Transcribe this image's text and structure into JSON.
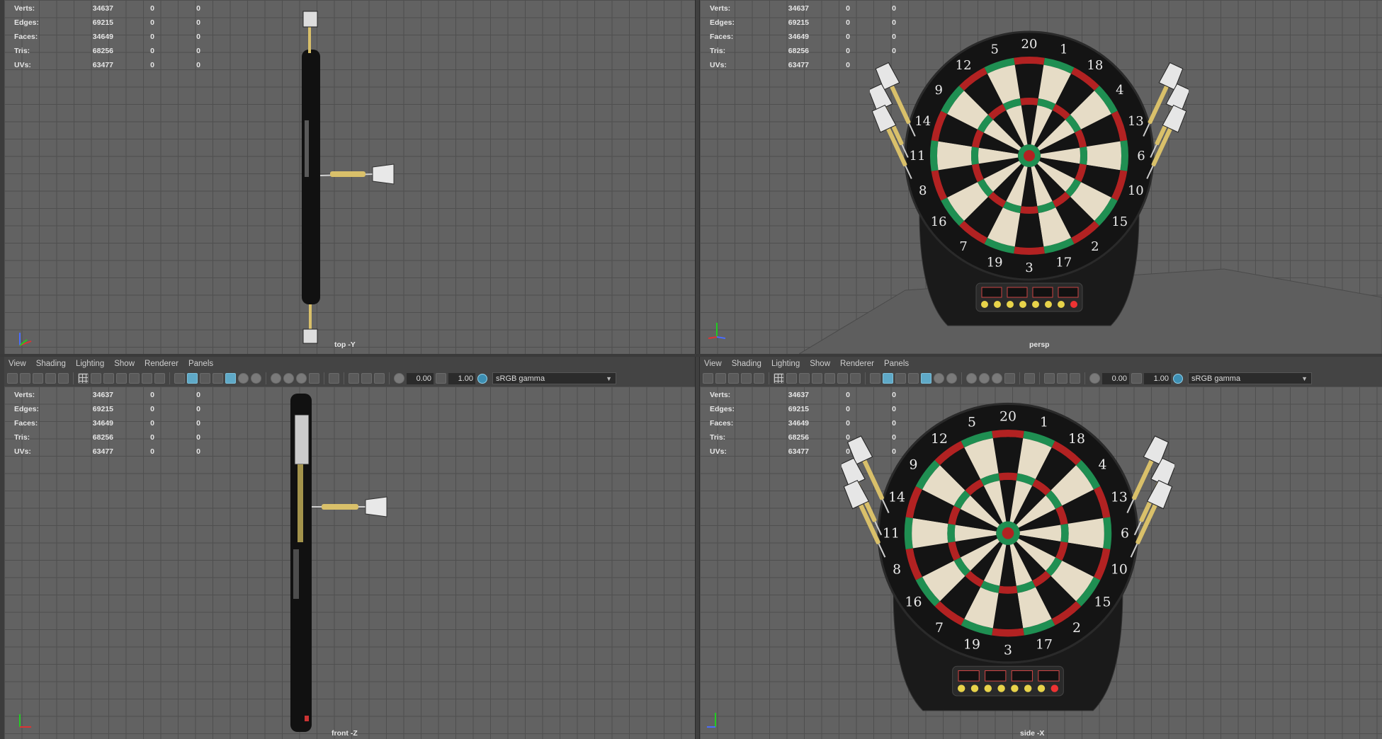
{
  "hud_stats": [
    {
      "label": "Verts:",
      "v1": "34637",
      "v2": "0",
      "v3": "0"
    },
    {
      "label": "Edges:",
      "v1": "69215",
      "v2": "0",
      "v3": "0"
    },
    {
      "label": "Faces:",
      "v1": "34649",
      "v2": "0",
      "v3": "0"
    },
    {
      "label": "Tris:",
      "v1": "68256",
      "v2": "0",
      "v3": "0"
    },
    {
      "label": "UVs:",
      "v1": "63477",
      "v2": "0",
      "v3": "0"
    }
  ],
  "viewports": {
    "top": {
      "camera": "top -Y"
    },
    "persp": {
      "camera": "persp"
    },
    "front": {
      "camera": "front -Z"
    },
    "side": {
      "camera": "side -X"
    }
  },
  "panel_menu": [
    "View",
    "Shading",
    "Lighting",
    "Show",
    "Renderer",
    "Panels"
  ],
  "toolbar": {
    "exposure": "0.00",
    "gamma": "1.00",
    "color_space": "sRGB gamma"
  },
  "dartboard_numbers": [
    "20",
    "1",
    "18",
    "4",
    "13",
    "6",
    "10",
    "15",
    "2",
    "17",
    "3",
    "19",
    "7",
    "16",
    "8",
    "11",
    "14",
    "9",
    "12",
    "5"
  ],
  "colors": {
    "viewport_bg": "#626262",
    "grid": "#4f4f4f",
    "board_black": "#141414",
    "board_cream": "#e6dcc6",
    "ring_red": "#b22222",
    "ring_green": "#1f8f52"
  }
}
